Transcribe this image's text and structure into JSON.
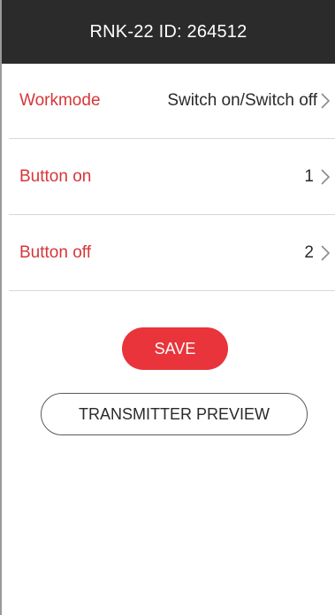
{
  "header": {
    "title": "RNK-22 ID: 264512"
  },
  "settings": [
    {
      "label": "Workmode",
      "value": "Switch on/Switch off",
      "icon": "chevron-right-icon"
    },
    {
      "label": "Button on",
      "value": "1",
      "icon": "chevron-right-icon"
    },
    {
      "label": "Button off",
      "value": "2",
      "icon": "chevron-right-icon"
    }
  ],
  "actions": {
    "save_label": "SAVE",
    "preview_label": "TRANSMITTER PREVIEW"
  },
  "colors": {
    "header_bg": "#2b2b2b",
    "accent": "#e8343a",
    "label_red": "#d6363a"
  }
}
